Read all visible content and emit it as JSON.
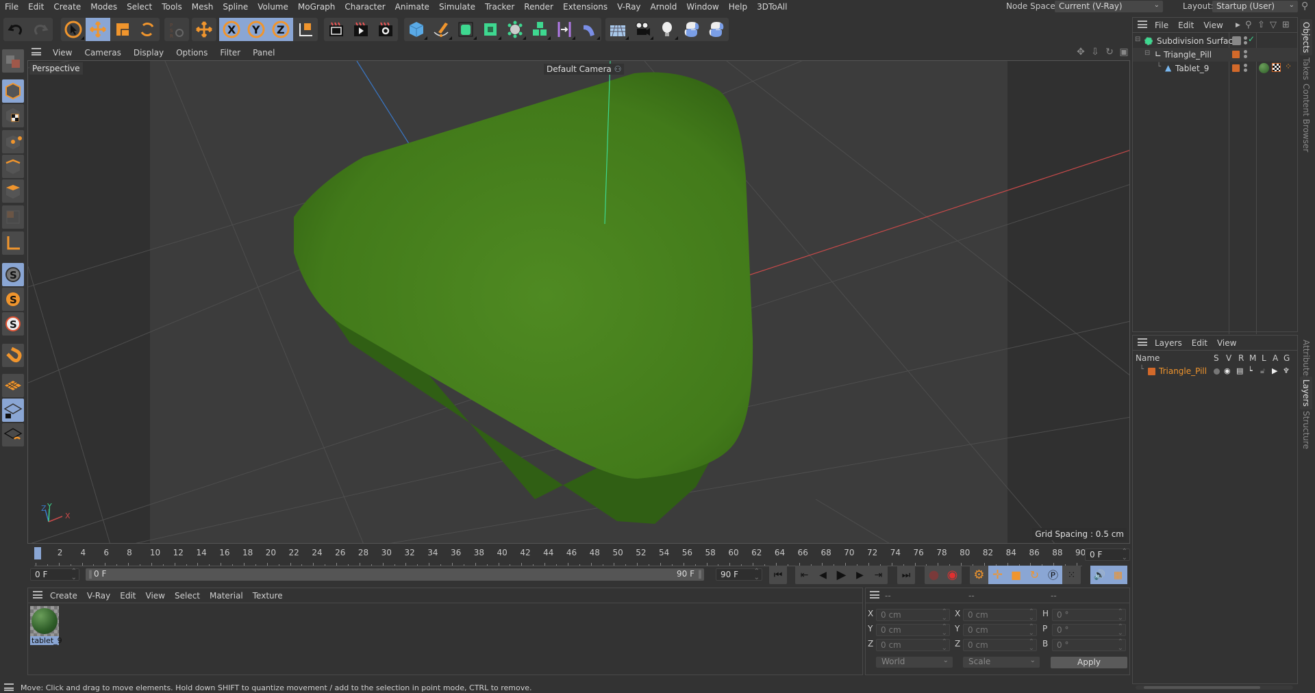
{
  "menubar": {
    "items": [
      "File",
      "Edit",
      "Create",
      "Modes",
      "Select",
      "Tools",
      "Mesh",
      "Spline",
      "Volume",
      "MoGraph",
      "Character",
      "Animate",
      "Simulate",
      "Tracker",
      "Render",
      "Extensions",
      "V-Ray",
      "Arnold",
      "Window",
      "Help",
      "3DToAll"
    ],
    "node_space_label": "Node Space:",
    "node_space_value": "Current (V-Ray)",
    "layout_label": "Layout:",
    "layout_value": "Startup (User)"
  },
  "toolbar": {
    "icons": [
      "undo-icon",
      "redo-icon",
      "select-arrow-icon",
      "move-icon",
      "scale-icon",
      "rotate-icon",
      "psr-icon",
      "add-object-icon",
      "x-axis-icon",
      "y-axis-icon",
      "z-axis-icon",
      "coordinate-system-icon",
      "render-view-icon",
      "render-picture-viewer-icon",
      "render-settings-icon",
      "cube-icon",
      "pen-spline-icon",
      "subdivision-icon",
      "extrude-generator-icon",
      "cloner-deformer-icon",
      "mograph-cloner-icon",
      "symmetry-icon",
      "bend-deformer-icon",
      "floor-icon",
      "camera-icon",
      "light-icon",
      "python-icon",
      "python-icon-2"
    ],
    "axis_labels": [
      "X",
      "Y",
      "Z"
    ]
  },
  "left_tools": [
    "model-mode-icon",
    "texture-mode-icon",
    "points-mode-icon",
    "edges-mode-icon",
    "polygons-mode-icon",
    "uv-mode-icon",
    "axis-mode-icon",
    "snap-icon",
    "snap-settings-icon",
    "snap-3d-icon",
    "magnet-icon",
    "workplane-icon",
    "locked-workplane-icon",
    "workplane-align-icon"
  ],
  "viewport": {
    "menu": [
      "View",
      "Cameras",
      "Display",
      "Options",
      "Filter",
      "Panel"
    ],
    "label": "Perspective",
    "camera_label": "Default Camera",
    "grid_spacing": "Grid Spacing : 0.5 cm",
    "axis_gizmo": [
      "Z",
      "Y",
      "X"
    ]
  },
  "timeline": {
    "ticks": [
      0,
      2,
      4,
      6,
      8,
      10,
      12,
      14,
      16,
      18,
      20,
      22,
      24,
      26,
      28,
      30,
      32,
      34,
      36,
      38,
      40,
      42,
      44,
      46,
      48,
      50,
      52,
      54,
      56,
      58,
      60,
      62,
      64,
      66,
      68,
      70,
      72,
      74,
      76,
      78,
      80,
      82,
      84,
      86,
      88,
      90
    ],
    "current_frame_field": "0 F",
    "start_field": "0 F",
    "range_start": "0 F",
    "range_end": "90 F",
    "end_field": "90 F"
  },
  "materials": {
    "menu": [
      "Create",
      "V-Ray",
      "Edit",
      "View",
      "Select",
      "Material",
      "Texture"
    ],
    "items": [
      {
        "name": "tablet_9"
      }
    ]
  },
  "coordinates": {
    "headers": [
      "--",
      "--",
      "--"
    ],
    "rows": [
      {
        "l1": "X",
        "v1": "0 cm",
        "l2": "X",
        "v2": "0 cm",
        "l3": "H",
        "v3": "0 °"
      },
      {
        "l1": "Y",
        "v1": "0 cm",
        "l2": "Y",
        "v2": "0 cm",
        "l3": "P",
        "v3": "0 °"
      },
      {
        "l1": "Z",
        "v1": "0 cm",
        "l2": "Z",
        "v2": "0 cm",
        "l3": "B",
        "v3": "0 °"
      }
    ],
    "space_dropdown": "World",
    "mode_dropdown": "Scale",
    "apply_label": "Apply"
  },
  "status": {
    "text": "Move: Click and drag to move elements. Hold down SHIFT to quantize movement / add to the selection in point mode, CTRL to remove."
  },
  "objects": {
    "menu": [
      "File",
      "Edit",
      "View"
    ],
    "items": [
      {
        "name": "Subdivision Surface",
        "icon": "subdivision-surface-icon",
        "depth": 0
      },
      {
        "name": "Triangle_Pill",
        "icon": "null-object-icon",
        "depth": 1
      },
      {
        "name": "Tablet_9",
        "icon": "polygon-object-icon",
        "depth": 2
      }
    ]
  },
  "layers": {
    "menu": [
      "Layers",
      "Edit",
      "View"
    ],
    "columns": [
      "Name",
      "S",
      "V",
      "R",
      "M",
      "L",
      "A",
      "G"
    ],
    "items": [
      {
        "name": "Triangle_Pill",
        "color": "#d2692a"
      }
    ]
  },
  "side_tabs": {
    "top": [
      "Objects",
      "Takes",
      "Content Browser"
    ],
    "bottom": [
      "Attributes",
      "Layers",
      "Structure"
    ]
  },
  "colors": {
    "accent_blue": "#8aa6d4",
    "orange": "#f0952d",
    "layer_orange": "#d2692a",
    "pill_green": "#4b7f1e"
  }
}
